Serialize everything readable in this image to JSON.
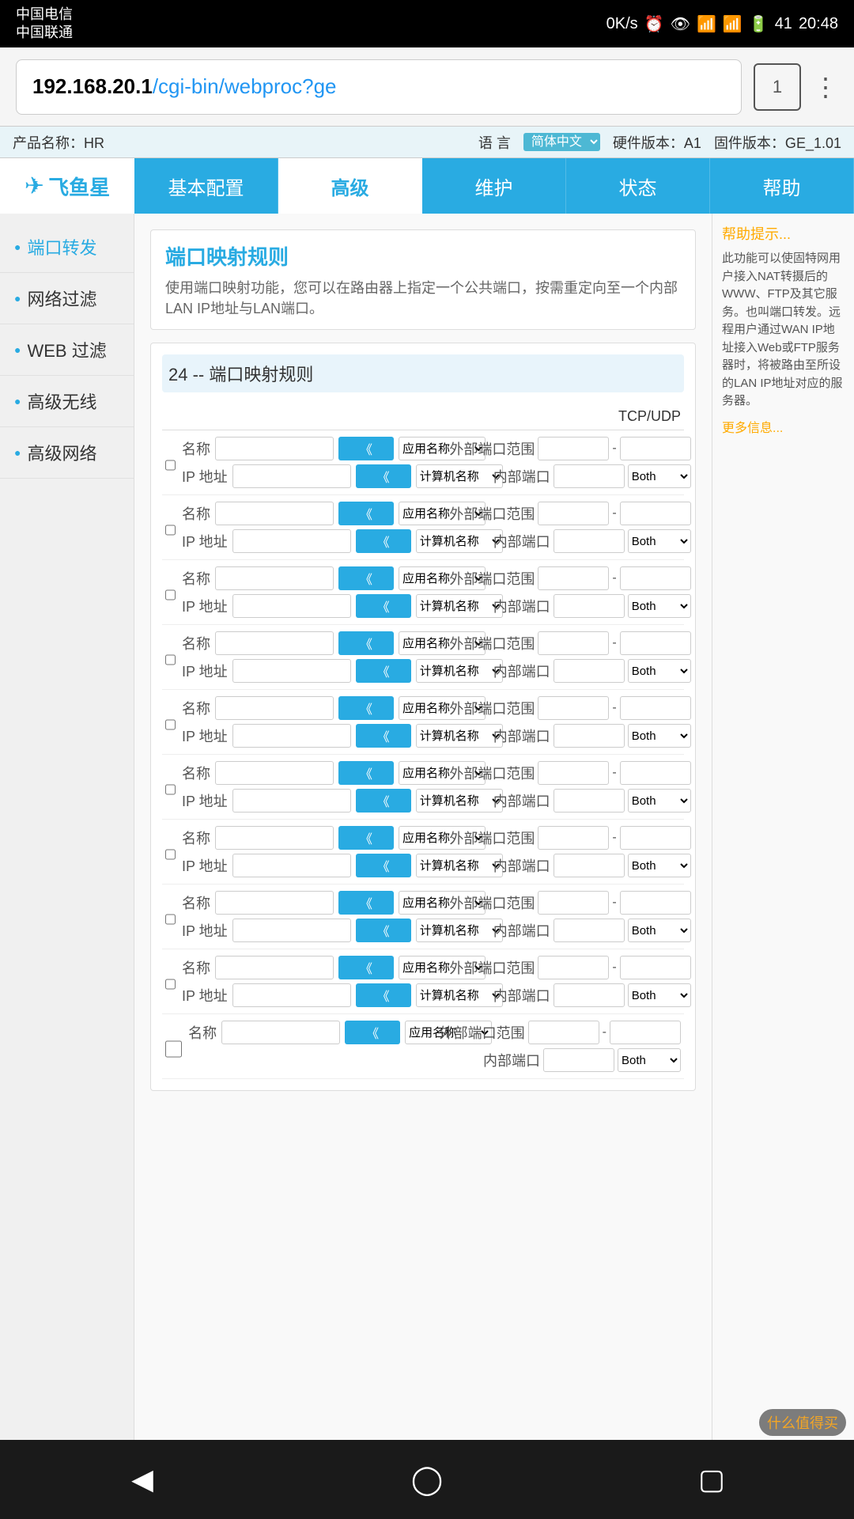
{
  "statusBar": {
    "carrier1": "中国电信",
    "carrier2": "中国联通",
    "weather": "☁",
    "speed": "0K/s",
    "battery": "41",
    "time": "20:48"
  },
  "browserBar": {
    "url": "192.168.20.1/cgi-bin/webproc?ge",
    "urlBlack": "192.168.20.1",
    "urlBlue": "/cgi-bin/webproc?ge",
    "tabCount": "1"
  },
  "productBar": {
    "productLabel": "产品名称：HR",
    "langLabel": "语 言",
    "langValue": "简体中文",
    "hwLabel": "硬件版本：A1",
    "fwLabel": "固件版本：GE_1.01"
  },
  "nav": {
    "logo": "飞鱼星",
    "tabs": [
      {
        "label": "基本配置"
      },
      {
        "label": "高级"
      },
      {
        "label": "维护"
      },
      {
        "label": "状态"
      },
      {
        "label": "帮助"
      }
    ],
    "activeTab": 1
  },
  "sidebar": {
    "items": [
      {
        "label": "端口转发",
        "active": true
      },
      {
        "label": "网络过滤",
        "active": false
      },
      {
        "label": "WEB 过滤",
        "active": false
      },
      {
        "label": "高级无线",
        "active": false
      },
      {
        "label": "高级网络",
        "active": false
      }
    ]
  },
  "help": {
    "title": "帮助提示...",
    "body": "此功能可以使固特网用户接入NAT转摄后的WWW、FTP及其它服务。也叫端口转发。远程用户通过WAN IP地址接入Web或FTP服务器时，将被路由至所设的LAN IP地址对应的服务器。",
    "moreLink": "更多信息..."
  },
  "page": {
    "title": "端口映射规则",
    "description": "使用端口映射功能，您可以在路由器上指定一个公共端口，按需重定向至一个内部LAN IP地址与LAN端口。",
    "rulesTitle": "24 -- 端口映射规则",
    "tcpUdpLabel": "TCP/UDP",
    "columnLabels": {
      "name": "名称",
      "appName": "应用名称",
      "extPortRange": "外部端口范围",
      "intPort": "内部端口",
      "ipAddr": "IP 地址",
      "compName": "计算机名称"
    },
    "bothLabel": "Both",
    "rowCount": 10
  },
  "footer": {
    "watermark": "什么值得买"
  }
}
